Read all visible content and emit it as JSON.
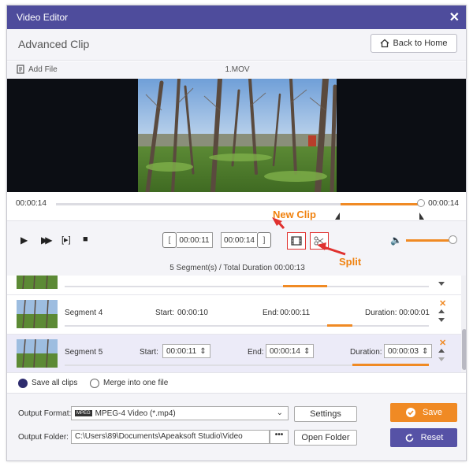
{
  "window": {
    "title": "Video Editor"
  },
  "header": {
    "title": "Advanced Clip",
    "back_label": "Back to Home"
  },
  "filebar": {
    "add_file_label": "Add File",
    "filename": "1.MOV"
  },
  "timeline": {
    "current_time": "00:00:14",
    "total_time": "00:00:14",
    "selection_start_fraction": 0.78,
    "selection_end_fraction": 1.0,
    "playhead_fraction": 1.0
  },
  "controls": {
    "start_time": "00:00:11",
    "end_time": "00:00:14",
    "volume_level": 0.9
  },
  "annotations": {
    "new_clip": "New Clip",
    "split": "Split"
  },
  "segments_summary": "5 Segment(s) / Total Duration 00:00:13",
  "segments": [
    {
      "name": "",
      "fill_start": 0.6,
      "fill_end": 0.72
    },
    {
      "name": "Segment 4",
      "start_label": "Start:",
      "start": "00:00:10",
      "end_label": "End:",
      "end": "00:00:11",
      "duration_label": "Duration:",
      "duration": "00:00:01",
      "fill_start": 0.72,
      "fill_end": 0.79
    },
    {
      "name": "Segment 5",
      "start_label": "Start:",
      "start": "00:00:11",
      "end_label": "End:",
      "end": "00:00:14",
      "duration_label": "Duration:",
      "duration": "00:00:03",
      "fill_start": 0.79,
      "fill_end": 1.0
    }
  ],
  "merge": {
    "save_all_label": "Save all clips",
    "merge_label": "Merge into one file",
    "selected": "save_all"
  },
  "output": {
    "format_label": "Output Format:",
    "format_value": "MPEG-4 Video (*.mp4)",
    "format_badge": "MPEG",
    "settings_label": "Settings",
    "folder_label": "Output Folder:",
    "folder_value": "C:\\Users\\89\\Documents\\Apeaksoft Studio\\Video",
    "browse_label": "•••",
    "open_folder_label": "Open Folder",
    "save_label": "Save",
    "reset_label": "Reset"
  },
  "colors": {
    "titlebar": "#4e4c9c",
    "accent": "#f08a24",
    "save_button": "#f08a24",
    "reset_button": "#5652a6",
    "annotation_arrow": "#e0312f",
    "annotation_text": "#f0820f"
  }
}
